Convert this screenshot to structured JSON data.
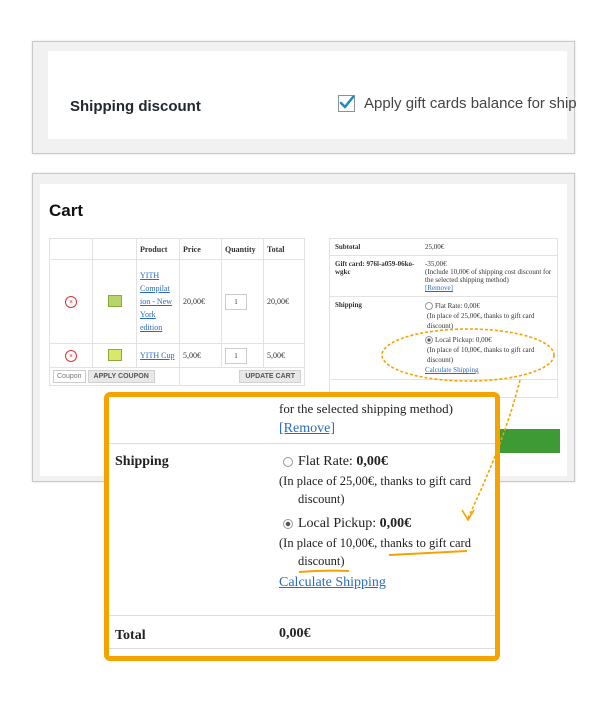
{
  "settings": {
    "label": "Shipping discount",
    "checkbox_label": "Apply gift cards balance for ship"
  },
  "cart": {
    "title": "Cart",
    "headers": [
      "Product",
      "Price",
      "Quantity",
      "Total"
    ],
    "rows": [
      {
        "product": "YITH Compilat ion - New York edition",
        "price": "20,00€",
        "qty": "1",
        "total": "20,00€"
      },
      {
        "product": "YITH Cup",
        "price": "5,00€",
        "qty": "1",
        "total": "5,00€"
      }
    ],
    "coupon_placeholder": "Coupon",
    "apply_coupon": "APPLY COUPON",
    "update_cart": "UPDATE CART"
  },
  "totals": {
    "subtotal_label": "Subtotal",
    "subtotal_value": "25,00€",
    "giftcard_label": "Gift card: 976l-a059-06ko-wgkc",
    "giftcard_value": "-35,00€",
    "giftcard_note": "(Include 10,00€ of shipping cost discount for the selected shipping method)",
    "remove": "[Remove]",
    "shipping_label": "Shipping",
    "flat_rate": "Flat Rate: 0,00€",
    "flat_note": "(In place of 25,00€, thanks to gift card discount)",
    "local_pickup": "Local Pickup: 0,00€",
    "local_note": "(In place of 10,00€, thanks to gift card discount)",
    "calc": "Calculate Shipping"
  },
  "zoom": {
    "top_note": "for the selected shipping method)",
    "remove": "[Remove]",
    "shipping_label": "Shipping",
    "flat_prefix": "Flat Rate: ",
    "flat_value": "0,00€",
    "flat_note_1": "(In place of 25,00€, thanks to gift card",
    "flat_note_2": "discount)",
    "local_prefix": "Local Pickup: ",
    "local_value": "0,00€",
    "local_note_1": "(In place of 10,00€, thanks to gift card",
    "local_note_2": "discount)",
    "calc": "Calculate Shipping",
    "total_label": "Total",
    "total_value": "0,00€"
  },
  "colors": {
    "highlight": "#f5a300",
    "link": "#2a6bbd",
    "checkout": "#3e9a35"
  }
}
